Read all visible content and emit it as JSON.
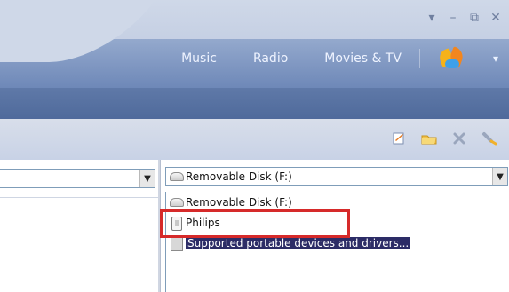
{
  "window_controls": {
    "menu": "▾",
    "minimize": "–",
    "restore": "⧉",
    "close": "✕"
  },
  "nav": {
    "tabs": [
      "Music",
      "Radio",
      "Movies & TV"
    ],
    "logo_chevron": "▾"
  },
  "left_pane": {
    "dropdown_arrow": "▼"
  },
  "right_pane": {
    "combobox_value": "Removable Disk (F:)",
    "dropdown_arrow": "▼",
    "items": [
      {
        "label": "Removable Disk (F:)"
      },
      {
        "label": "Philips"
      },
      {
        "label": "Supported portable devices and drivers..."
      }
    ]
  },
  "toolbar": {
    "icons": [
      "edit-playlist-icon",
      "folder-icon",
      "delete-icon",
      "sync-icon"
    ]
  },
  "colors": {
    "highlight_border": "#d62a2a",
    "selection_bg": "#2c2c66"
  }
}
